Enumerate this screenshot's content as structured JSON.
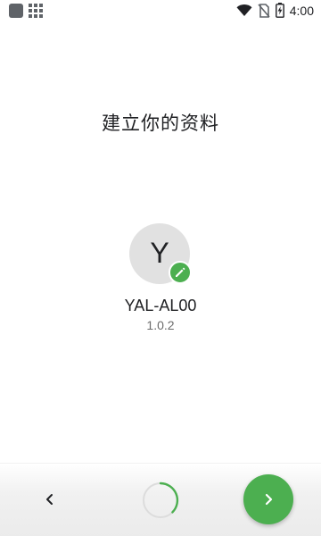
{
  "status_bar": {
    "time": "4:00",
    "icons": [
      "notification-square-icon",
      "app-grid-icon",
      "wifi-icon",
      "no-sim-icon",
      "battery-charging-icon"
    ]
  },
  "page": {
    "title": "建立你的资料"
  },
  "profile": {
    "avatar_letter": "Y",
    "edit_icon": "pencil-icon",
    "device_name": "YAL-AL00",
    "version": "1.0.2"
  },
  "navigation": {
    "back_icon": "chevron-left-icon",
    "next_icon": "chevron-right-icon",
    "spinner_icon": "progress-spinner-icon"
  },
  "colors": {
    "accent": "#4caf50",
    "avatar_bg": "#e1e1e1",
    "text_primary": "#202124",
    "text_secondary": "#6b6b6b"
  }
}
